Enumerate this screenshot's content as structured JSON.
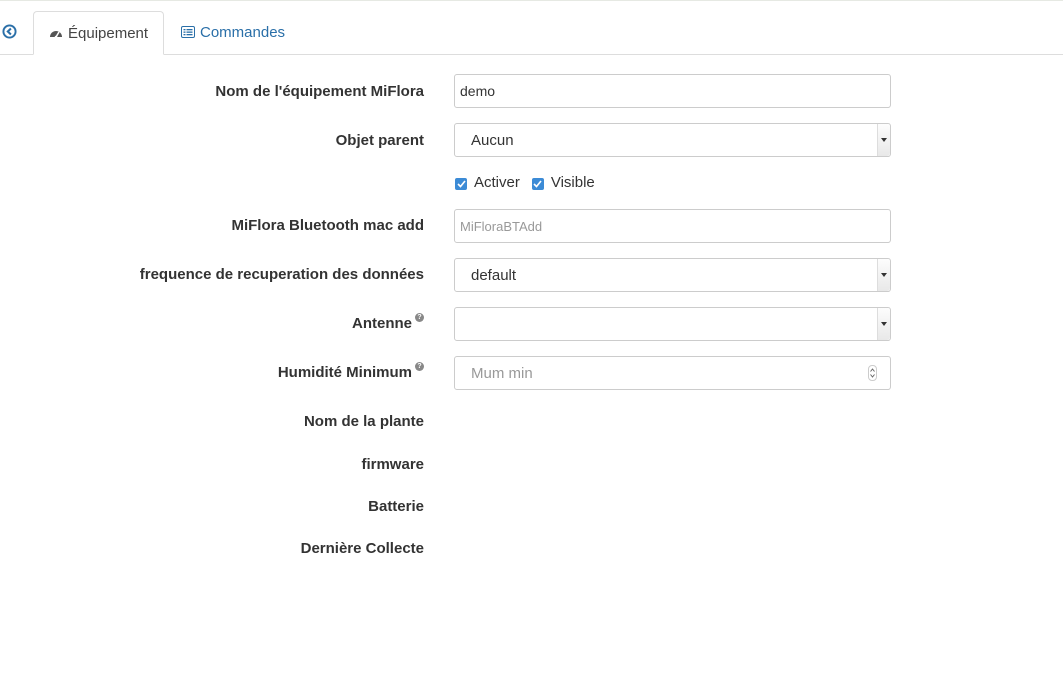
{
  "tabs": {
    "equipment_label": "Équipement",
    "commands_label": "Commandes"
  },
  "form": {
    "name_label": "Nom de l'équipement MiFlora",
    "name_value": "demo",
    "parent_label": "Objet parent",
    "parent_value": "Aucun",
    "activer_label": "Activer",
    "visible_label": "Visible",
    "mac_label": "MiFlora Bluetooth mac add",
    "mac_placeholder": "MiFloraBTAdd",
    "freq_label": "frequence de recuperation des données",
    "freq_value": "default",
    "antenne_label": "Antenne",
    "antenne_value": "",
    "humidity_label": "Humidité Minimum",
    "humidity_placeholder": "Mum min",
    "plant_label": "Nom de la plante",
    "firmware_label": "firmware",
    "battery_label": "Batterie",
    "last_collect_label": "Dernière Collecte"
  },
  "colors": {
    "accent": "#2a6fa8",
    "checkbox": "#3c8bd6"
  }
}
